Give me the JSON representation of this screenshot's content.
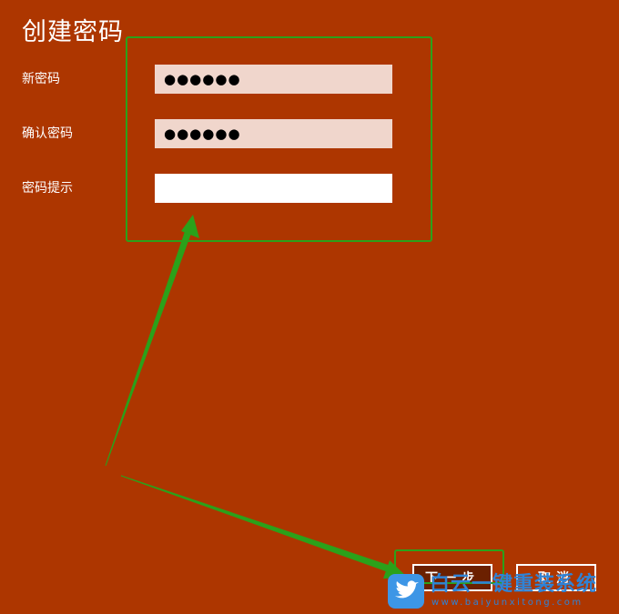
{
  "dialog": {
    "title": "创建密码",
    "fields": [
      {
        "label": "新密码",
        "value": "●●●●●●"
      },
      {
        "label": "确认密码",
        "value": "●●●●●●"
      },
      {
        "label": "密码提示",
        "value": ""
      }
    ],
    "buttons": {
      "next_label": "下一步",
      "cancel_label": "取消"
    }
  },
  "watermark": {
    "text": "白云一键重装系统",
    "url": "www.baiyunxitong.com",
    "logo_icon": "bird-icon"
  },
  "colors": {
    "background": "#ad3600",
    "annotation_green": "#2ba11a",
    "password_field_bg": "#f0d6cc",
    "watermark_blue": "#2f83d6"
  }
}
